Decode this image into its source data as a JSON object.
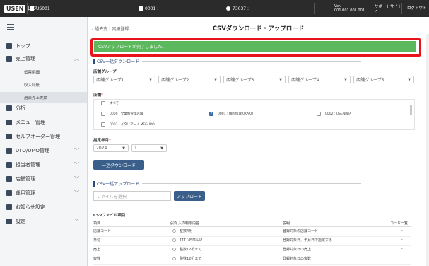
{
  "topbar": {
    "brand": "USEN",
    "brand_sub": "レジ",
    "account": "US001 : ",
    "store": "0001 : ",
    "user": "73637 : ",
    "ver_label": "Ver.",
    "version": "001.001.001.001",
    "support": "サポートサイト",
    "logout": "ログアウト"
  },
  "sidebar": {
    "items": [
      {
        "label": "トップ",
        "icon": "home-icon"
      },
      {
        "label": "売上管理",
        "icon": "sales-icon"
      },
      {
        "label": "分析",
        "icon": "chart-icon"
      },
      {
        "label": "メニュー管理",
        "icon": "menu-icon"
      },
      {
        "label": "セルフオーダー管理",
        "icon": "order-icon"
      },
      {
        "label": "UTO/UMO管理",
        "icon": "uto-icon"
      },
      {
        "label": "担当者管理",
        "icon": "staff-icon"
      },
      {
        "label": "店舗管理",
        "icon": "store-icon"
      },
      {
        "label": "運用管理",
        "icon": "ops-icon"
      },
      {
        "label": "お知らせ設定",
        "icon": "bell-icon"
      },
      {
        "label": "設定",
        "icon": "gear-icon"
      }
    ],
    "sub_items": [
      {
        "label": "伝票明細"
      },
      {
        "label": "収入印紙"
      },
      {
        "label": "過去売上実績"
      }
    ]
  },
  "main": {
    "back_link": "過去売上実績登録",
    "title": "CSVダウンロード・アップロード",
    "success_message": "CSVアップロードが完了しました。",
    "download_section": "CSV一括ダウンロード",
    "store_group_label": "店舗グループ",
    "groups": [
      "店舗グループ1",
      "店舗グループ2",
      "店舗グループ3",
      "店舗グループ4",
      "店舗グループ5"
    ],
    "store_label": "店舗",
    "stores": [
      {
        "label": "すべて",
        "checked": false
      },
      {
        "label": "0000 : 全業態管理店舗",
        "checked": false
      },
      {
        "label": "0001 : 麺固料理KIKAKU",
        "checked": true
      },
      {
        "label": "0002 : USEN飯店",
        "checked": false
      },
      {
        "label": "0003 : イタリアーノ MEGURO",
        "checked": false
      }
    ],
    "period_label": "指定年月",
    "year": "2024",
    "month": "1",
    "download_button": "一括ダウンロード",
    "upload_section": "CSV一括アップロード",
    "file_placeholder": "ファイルを選択",
    "upload_button": "アップロード",
    "table_title": "CSVファイル項目",
    "headers": [
      "項目",
      "必須",
      "入力制限内容",
      "説明",
      "コード一覧"
    ],
    "rows": [
      {
        "item": "店舗コード",
        "limit": "整数4桁",
        "desc": "登録対象の店舗コード",
        "code": "-"
      },
      {
        "item": "日付",
        "limit": "YYYY/MM/DD",
        "desc": "登録対象日。年月日で指定する",
        "code": "-"
      },
      {
        "item": "売上",
        "limit": "整数12桁まで",
        "desc": "登録対象日の売上",
        "code": "-"
      },
      {
        "item": "客数",
        "limit": "整数12桁まで",
        "desc": "登録対象日の客数",
        "code": "-"
      }
    ]
  },
  "colors": {
    "success": "#5cb85c",
    "highlight": "#e8141b",
    "primary": "#3a5f8a"
  }
}
